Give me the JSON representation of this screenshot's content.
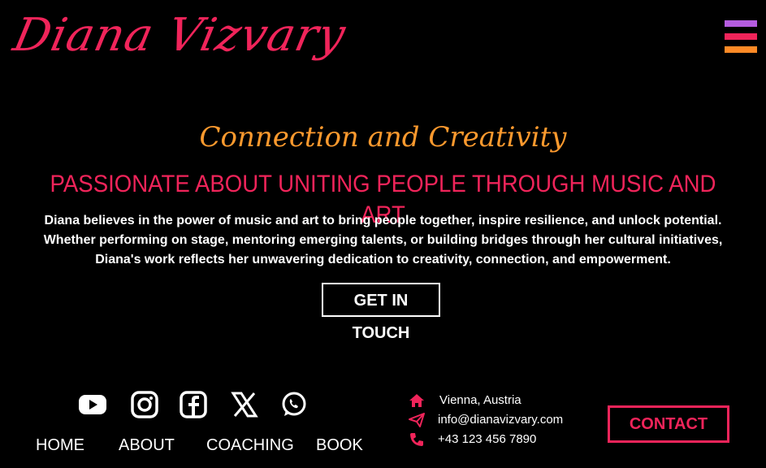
{
  "site": {
    "logo_text": "Diana Vizvary"
  },
  "colors": {
    "accent_pink": "#f0245a",
    "accent_orange": "#ff8a26",
    "accent_purple": "#b55ce0",
    "background": "#000000"
  },
  "hero": {
    "tagline": "Connection and Creativity",
    "headline": "PASSIONATE ABOUT UNITING PEOPLE THROUGH MUSIC AND ART",
    "intro": "Diana believes in the power of music and art to bring people together, inspire resilience, and unlock potential. Whether performing on stage, mentoring emerging talents, or building bridges through her cultural initiatives, Diana's work reflects her unwavering dedication to creativity, connection, and empowerment.",
    "cta_label": "GET IN TOUCH"
  },
  "socials": [
    "youtube-icon",
    "instagram-icon",
    "facebook-icon",
    "x-icon",
    "whatsapp-icon"
  ],
  "nav": {
    "home": "HOME",
    "about": "ABOUT",
    "coaching": "COACHING",
    "book": "BOOK"
  },
  "contact": {
    "location": "Vienna, Austria",
    "email": "info@dianavizvary.com",
    "phone": "+43 123 456 7890",
    "button_label": "CONTACT"
  }
}
